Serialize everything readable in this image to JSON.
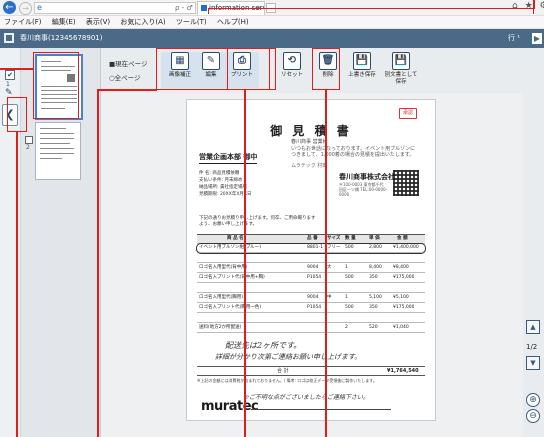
{
  "browser": {
    "tab_title": "information server T",
    "menu": [
      "ファイル(F)",
      "編集(E)",
      "表示(V)",
      "お気に入り(A)",
      "ツール(T)",
      "ヘルプ(H)"
    ],
    "addr_tools": "ρ - ♂",
    "right_icons": "⌂ ★ ⚙"
  },
  "app": {
    "title": "春川商事(12345678901)",
    "right_label": "行 ¹",
    "right_btn": "▶"
  },
  "left_icons": {
    "check": "✔",
    "count": "1",
    "edit": "✎",
    "collapse": "❮"
  },
  "thumbs": {
    "page_number": "2"
  },
  "toolbar": {
    "scope_current": "■現在ページ",
    "scope_all": "○全ページ",
    "buttons": [
      {
        "label": "画像補正",
        "glyph": "▦"
      },
      {
        "label": "編集",
        "glyph": "✎"
      },
      {
        "label": "プリント",
        "glyph": "⎙"
      },
      {
        "label": "リセット",
        "glyph": "⟲"
      },
      {
        "label": "削除",
        "glyph": "🗑"
      },
      {
        "label": "上書き保存",
        "glyph": "💾"
      },
      {
        "label": "別文書として保存",
        "glyph": "💾"
      }
    ]
  },
  "document": {
    "stamp": "承認",
    "title": "御 見 積 書",
    "subtitle": "春川商事 営業様",
    "greeting": "いつもお世話になっております。イベント用ブルゾンにつきまして、1,000着の場合の見積を提出いたします。",
    "addressee": "営業企画本部 御中",
    "sign": "ムラテック 村田",
    "issuer": "春川商事株式会社",
    "issuer_addr": "〒100-0003 東京都千代田区一ツ橋 TEL:00-0000-0000",
    "info": [
      "件 名: 商品見積依頼",
      "支払い条件: 月末締め",
      "納品場所: 貴社指定場所",
      "見積期限: 20XX年X月X日"
    ],
    "note": "下記の通りお見積り申し上げます。何卒、ご用命賜りますよう、お願い申し上げます。",
    "table_head": [
      "商 品 名",
      "品 番",
      "サイズ",
      "数 量",
      "単 価",
      "金 額"
    ],
    "table_rows": [
      [
        "イベント用ブルゾン紺(ブルー)",
        "8801-1",
        "フリー",
        "500",
        "2,800",
        "¥1,400,000"
      ],
      [
        "",
        "",
        "",
        "",
        "",
        ""
      ],
      [
        "ロゴ名入用型代(背中用)",
        "9004",
        "大",
        "1",
        "8,400",
        "¥8,400"
      ],
      [
        "ロゴ名入プリント代(背中用+胸)",
        "P1054",
        "",
        "500",
        "350",
        "¥175,000"
      ],
      [
        "",
        "",
        "",
        "",
        "",
        ""
      ],
      [
        "ロゴ名入用型代(胸用)",
        "9004",
        "中",
        "1",
        "5,100",
        "¥5,100"
      ],
      [
        "ロゴ名入プリント代(胸用一色)",
        "P1054",
        "",
        "500",
        "350",
        "¥175,000"
      ],
      [
        "",
        "",
        "",
        "",
        "",
        ""
      ],
      [
        "送料(地方2か所配送)",
        "",
        "",
        "2",
        "520",
        "¥1,040"
      ]
    ],
    "hand_note_1": "配送先は2ヶ所です。",
    "hand_note_2": "詳細が分かり次第ご連絡お願い申し上げます。",
    "total_label": "合 計",
    "total_value": "¥1,764,540",
    "remarks": "※上記の金額には消費税が含まれておりません。/ 備考: ロゴは校正データ受領後に製作いたします。",
    "hand_note_3": "※ご不明な点がございましたらご連絡下さい。",
    "brand": "muratec"
  },
  "pager": {
    "up": "▲",
    "page": "1/2",
    "down": "▼",
    "zoom_in": "⊕",
    "zoom_out": "⊖"
  }
}
